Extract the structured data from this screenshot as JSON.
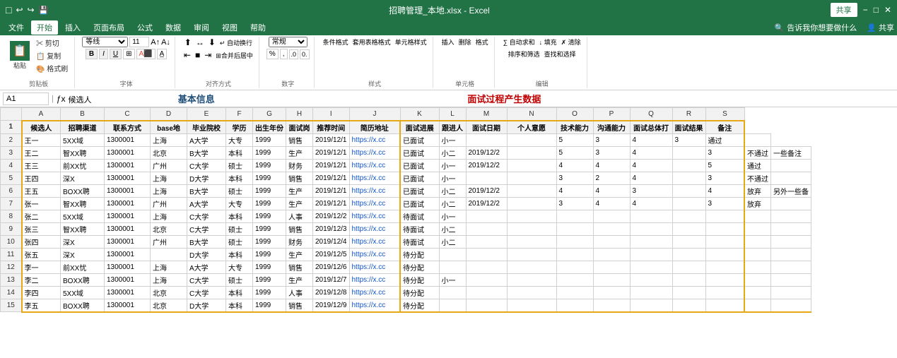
{
  "titlebar": {
    "title": "招聘管理_本地.xlsx - Excel",
    "share": "共享"
  },
  "ribbon": {
    "tabs": [
      "文件",
      "开始",
      "插入",
      "页面布局",
      "公式",
      "数据",
      "审阅",
      "视图",
      "帮助"
    ],
    "active_tab": "开始",
    "search_placeholder": "告诉我你想要做什么"
  },
  "toolbar_groups": {
    "clipboard": "剪贴板",
    "font": "字体",
    "alignment": "对齐方式",
    "number": "数字",
    "styles": "样式",
    "cells": "单元格",
    "editing": "编辑"
  },
  "formula_bar": {
    "cell_ref": "A1",
    "formula": "候选人"
  },
  "section_labels": {
    "basic_info": "基本信息",
    "interview_data": "面试过程产生数据"
  },
  "columns": {
    "headers": [
      "A",
      "B",
      "C",
      "D",
      "E",
      "F",
      "G",
      "H",
      "I",
      "J",
      "K",
      "L",
      "M",
      "N",
      "O",
      "P",
      "Q",
      "R",
      "S"
    ],
    "widths": [
      55,
      62,
      65,
      60,
      55,
      40,
      38,
      38,
      38,
      70,
      55,
      40,
      55,
      70,
      55,
      55,
      58,
      40,
      55
    ]
  },
  "sheet_headers": [
    "候选人",
    "招聘渠道",
    "联系方式",
    "base地",
    "毕业院校",
    "学历",
    "出生年份",
    "面试岗",
    "推荐时间",
    "简历地址",
    "面试进展",
    "跟进人",
    "面试日期",
    "个人意愿",
    "技术能力",
    "沟通能力",
    "面试总体打面试结果",
    "备注"
  ],
  "rows": [
    [
      "王一",
      "5XX域",
      "1300001",
      "上海",
      "A大学",
      "大专",
      "1999",
      "销售",
      "2019/12/1",
      "https://x.cc",
      "已面试",
      "小一",
      "",
      "",
      "5",
      "3",
      "4",
      "3",
      "通过",
      ""
    ],
    [
      "王二",
      "智XX聘",
      "1300001",
      "北京",
      "B大学",
      "本科",
      "1999",
      "生产",
      "2019/12/1",
      "https://x.cc",
      "已面试",
      "小二",
      "2019/12/2",
      "",
      "5",
      "3",
      "4",
      "",
      "3",
      "不通过",
      "一些备注"
    ],
    [
      "王三",
      "前XX忧",
      "1300001",
      "广州",
      "C大学",
      "硕士",
      "1999",
      "财务",
      "2019/12/1",
      "https://x.cc",
      "已面试",
      "小一",
      "2019/12/2",
      "",
      "4",
      "4",
      "4",
      "",
      "5",
      "通过",
      ""
    ],
    [
      "王四",
      "深X",
      "1300001",
      "上海",
      "D大学",
      "本科",
      "1999",
      "销售",
      "2019/12/1",
      "https://x.cc",
      "已面试",
      "小一",
      "",
      "",
      "3",
      "2",
      "4",
      "",
      "3",
      "不通过",
      ""
    ],
    [
      "王五",
      "BOXX聘",
      "1300001",
      "上海",
      "B大学",
      "硕士",
      "1999",
      "生产",
      "2019/12/1",
      "https://x.cc",
      "已面试",
      "小二",
      "2019/12/2",
      "",
      "4",
      "4",
      "3",
      "",
      "4",
      "放弃",
      "另外一些备"
    ],
    [
      "张一",
      "智XX聘",
      "1300001",
      "广州",
      "A大学",
      "大专",
      "1999",
      "生产",
      "2019/12/1",
      "https://x.cc",
      "已面试",
      "小二",
      "2019/12/2",
      "",
      "3",
      "4",
      "4",
      "",
      "3",
      "放弃",
      ""
    ],
    [
      "张二",
      "5XX域",
      "1300001",
      "上海",
      "C大学",
      "本科",
      "1999",
      "人事",
      "2019/12/2",
      "https://x.cc",
      "待面试",
      "小一",
      "",
      "",
      "",
      "",
      "",
      "",
      "",
      "",
      ""
    ],
    [
      "张三",
      "智XX聘",
      "1300001",
      "北京",
      "C大学",
      "硕士",
      "1999",
      "销售",
      "2019/12/3",
      "https://x.cc",
      "待面试",
      "小二",
      "",
      "",
      "",
      "",
      "",
      "",
      "",
      "",
      ""
    ],
    [
      "张四",
      "深X",
      "1300001",
      "广州",
      "B大学",
      "硕士",
      "1999",
      "财务",
      "2019/12/4",
      "https://x.cc",
      "待面试",
      "小二",
      "",
      "",
      "",
      "",
      "",
      "",
      "",
      "",
      ""
    ],
    [
      "张五",
      "深X",
      "1300001",
      "",
      "D大学",
      "本科",
      "1999",
      "生产",
      "2019/12/5",
      "https://x.cc",
      "待分配",
      "",
      "",
      "",
      "",
      "",
      "",
      "",
      "",
      "",
      ""
    ],
    [
      "李一",
      "前XX忧",
      "1300001",
      "上海",
      "A大学",
      "大专",
      "1999",
      "销售",
      "2019/12/6",
      "https://x.cc",
      "待分配",
      "",
      "",
      "",
      "",
      "",
      "",
      "",
      "",
      "",
      ""
    ],
    [
      "李二",
      "BOXX聘",
      "1300001",
      "上海",
      "C大学",
      "硕士",
      "1999",
      "生产",
      "2019/12/7",
      "https://x.cc",
      "待分配",
      "小一",
      "",
      "",
      "",
      "",
      "",
      "",
      "",
      "",
      ""
    ],
    [
      "李四",
      "5XX域",
      "1300001",
      "北京",
      "C大学",
      "本科",
      "1999",
      "人事",
      "2019/12/8",
      "https://x.cc",
      "待分配",
      "",
      "",
      "",
      "",
      "",
      "",
      "",
      "",
      "",
      ""
    ],
    [
      "李五",
      "BOXX聘",
      "1300001",
      "北京",
      "D大学",
      "本科",
      "1999",
      "销售",
      "2019/12/9",
      "https://x.cc",
      "待分配",
      "",
      "",
      "",
      "",
      "",
      "",
      "",
      "",
      "",
      ""
    ]
  ]
}
